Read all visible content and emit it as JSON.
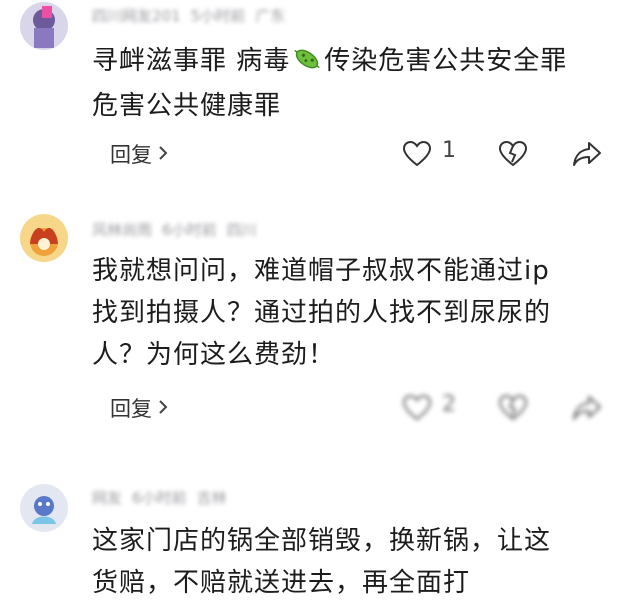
{
  "comments": [
    {
      "author": "四川网友201",
      "meta_time": "5小时前",
      "meta_location": "广东",
      "text_line1_a": "寻衅滋事罪 病毒",
      "text_line1_b": "传染危害公共安全罪",
      "text_line2": "危害公共健康罪",
      "emoji_icon": "microbe-icon",
      "reply_label": "回复",
      "like_count": "1"
    },
    {
      "author": "风林尚雨",
      "meta_time": "6小时前",
      "meta_location": "四川",
      "text_lines": [
        "我就想问问，难道帽子叔叔不能通过ip",
        "找到拍摄人？通过拍的人找不到尿尿的",
        "人？为何这么费劲！"
      ],
      "reply_label": "回复",
      "like_count": "2"
    },
    {
      "author": "网友",
      "meta_time": "6小时前",
      "meta_location": "吉林",
      "text_lines": [
        "这家门店的锅全部销毁，换新锅，让这",
        "货赔，不赔就送进去，再全面打"
      ]
    }
  ],
  "colors": {
    "virus_green": "#6fbf3c",
    "text": "#1c1c1c",
    "icon_stroke": "#333333"
  }
}
